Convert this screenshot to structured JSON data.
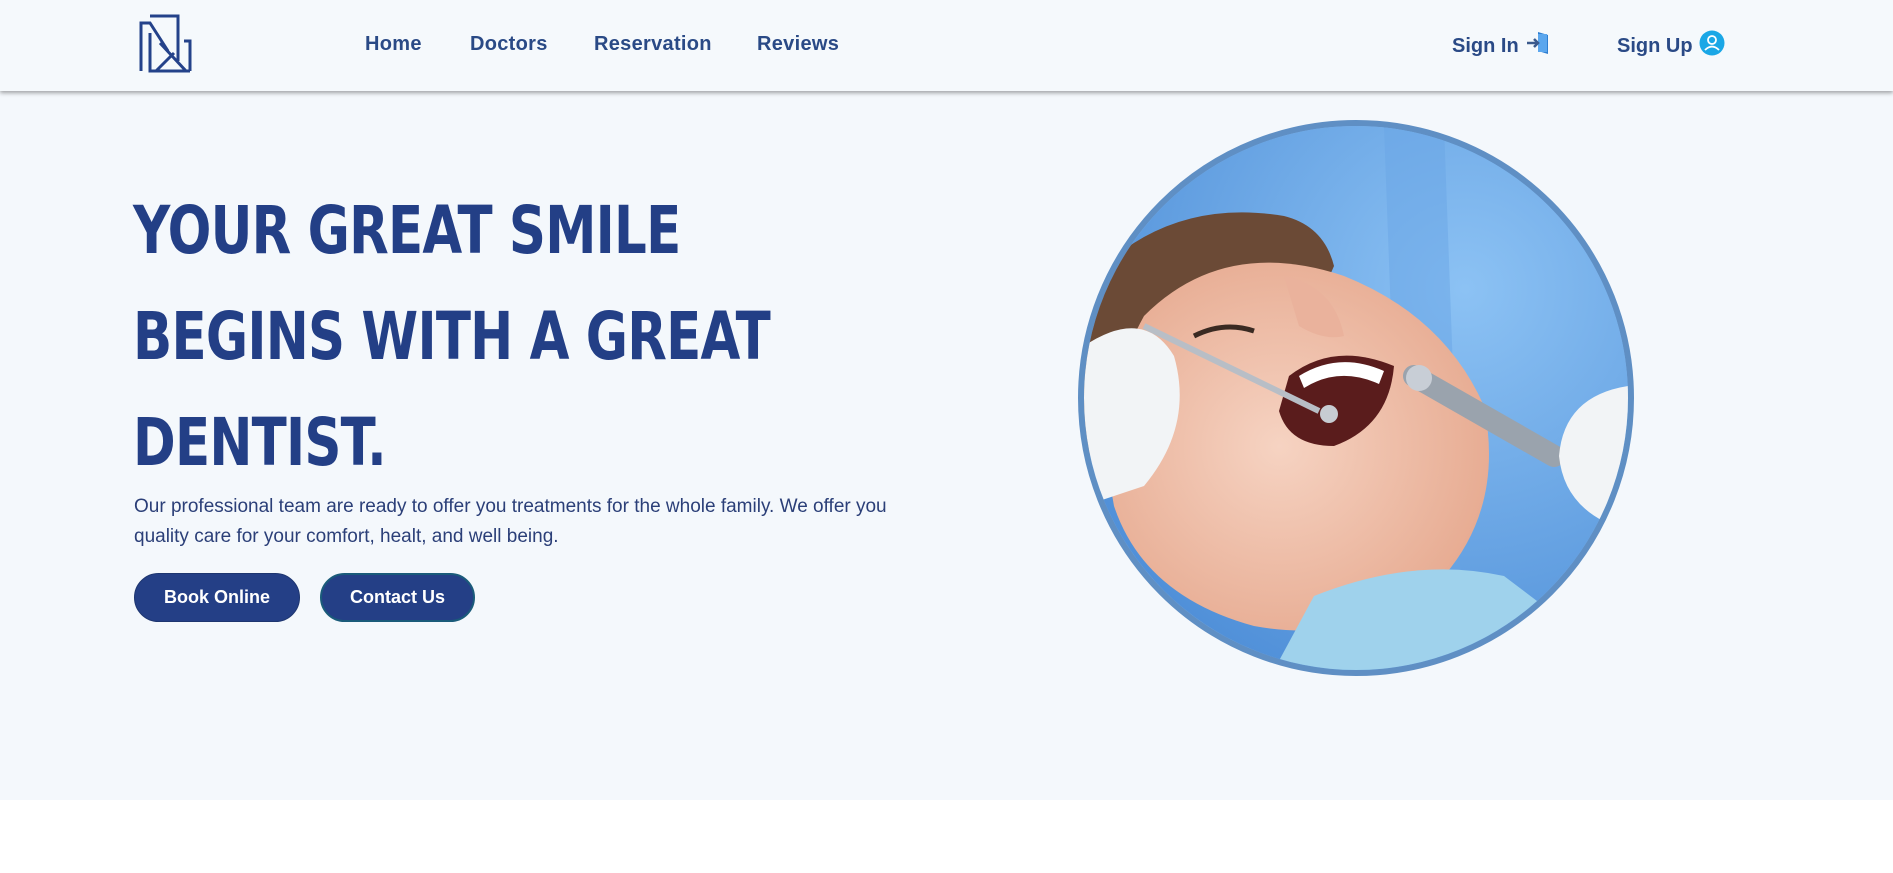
{
  "nav": {
    "links": [
      "Home",
      "Doctors",
      "Reservation",
      "Reviews"
    ],
    "sign_in": "Sign In",
    "sign_up": "Sign Up",
    "logo_icon": "logo-icon",
    "sign_in_icon": "login-icon",
    "sign_up_icon": "user-icon"
  },
  "hero": {
    "title_lines": [
      "YOUR GREAT SMILE",
      "BEGINS WITH A GREAT",
      "DENTIST."
    ],
    "description": "Our professional team are ready to offer you treatments for the whole family. We offer you quality care for your comfort, healt, and well being.",
    "book_button": "Book Online",
    "contact_button": "Contact Us",
    "image_subject": "dental-patient-photo"
  },
  "colors": {
    "brand": "#243f86",
    "background": "#f4f8fc",
    "accent_cyan": "#1aa7e6"
  }
}
